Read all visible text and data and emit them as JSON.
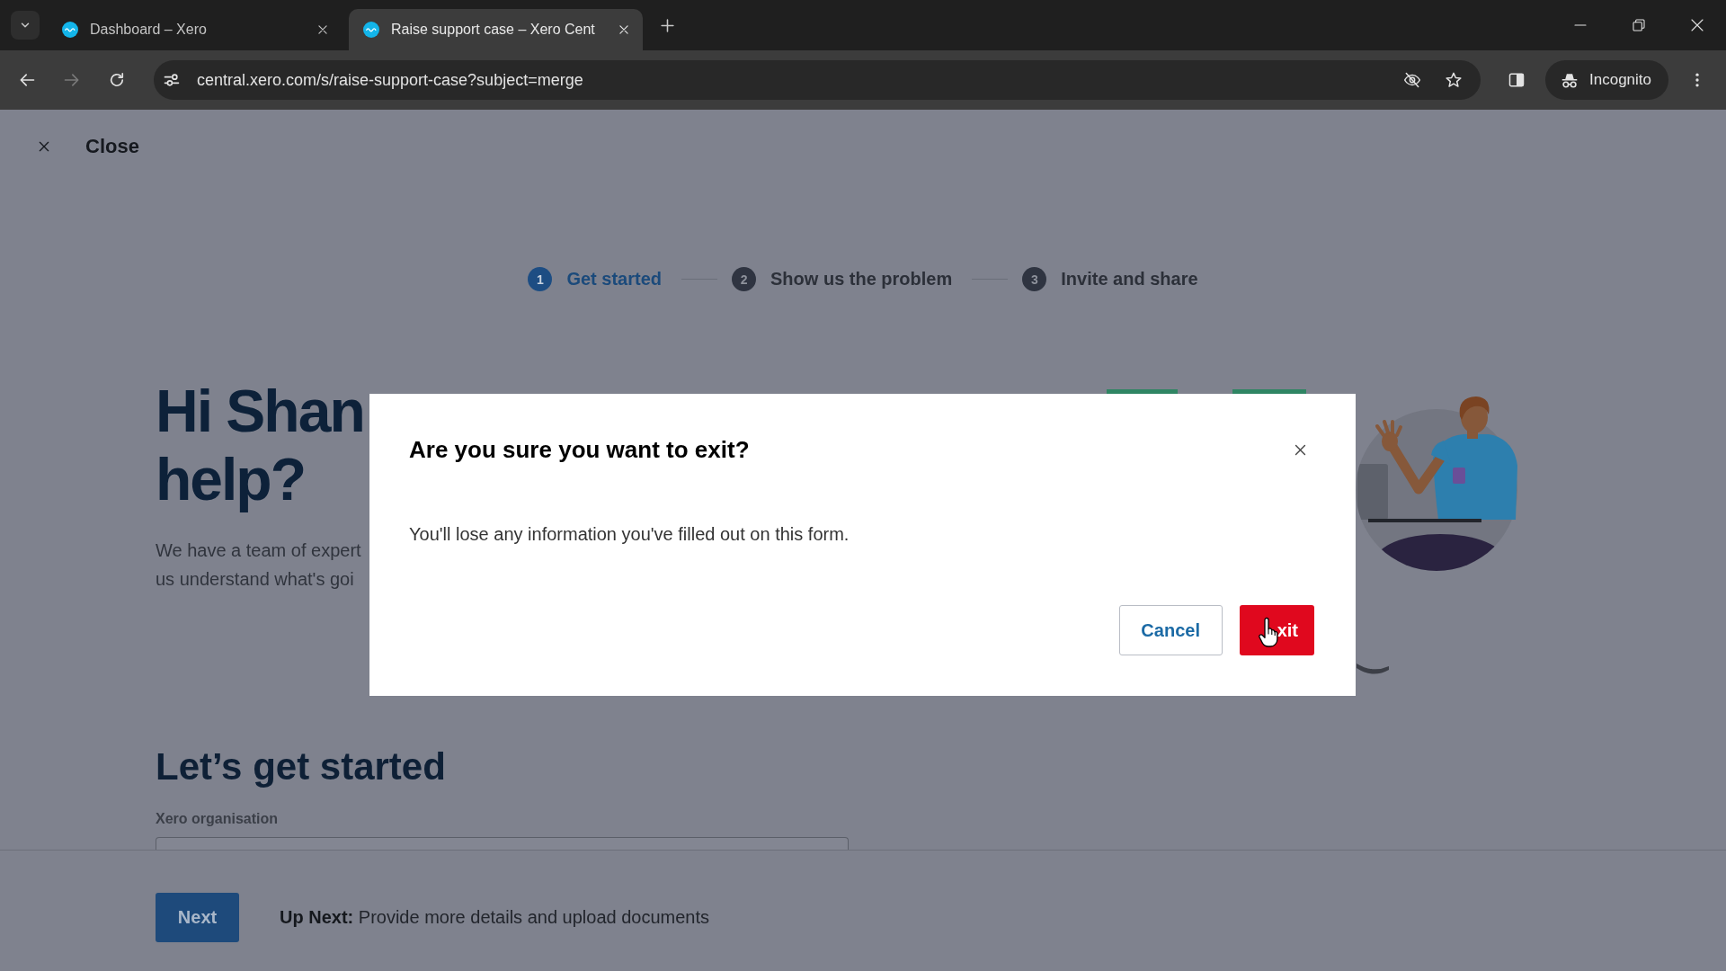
{
  "browser": {
    "tabs": [
      {
        "title": "Dashboard – Xero",
        "selected": false
      },
      {
        "title": "Raise support case – Xero Cent",
        "selected": true
      }
    ],
    "forward_disabled": true,
    "address": "central.xero.com/s/raise-support-case?subject=merge",
    "profile": "Incognito"
  },
  "page": {
    "close_label": "Close",
    "steps": [
      {
        "number": "1",
        "label": "Get started",
        "selected": true
      },
      {
        "number": "2",
        "label": "Show us the problem",
        "selected": false
      },
      {
        "number": "3",
        "label": "Invite and share",
        "selected": false
      }
    ],
    "heading_lines": [
      "Hi Shan",
      "help?"
    ],
    "intro_lines": [
      "We have a team of expert",
      "us understand what's goi"
    ],
    "section_title": "Let’s get started",
    "field_label": "Xero organisation",
    "next_button": "Next",
    "up_next": "**Up Next:** Provide more details and upload documents"
  },
  "dialog": {
    "title": "Are you sure you want to exit?",
    "message": "You'll lose any information you've filled out on this form.",
    "buttons": [
      {
        "label": "Cancel",
        "kind": "secondary"
      },
      {
        "label": "xit",
        "kind": "primary"
      }
    ]
  }
}
